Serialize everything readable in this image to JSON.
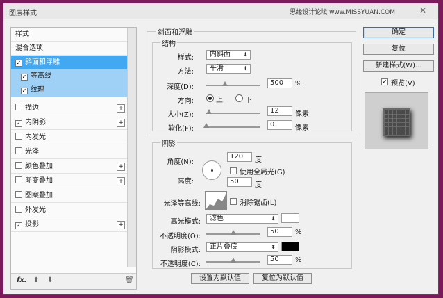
{
  "window": {
    "title": "图层样式",
    "watermark": "思缘设计论坛 www.MISSYUAN.COM",
    "close": "✕"
  },
  "styles_list": {
    "header": "样式",
    "items": [
      {
        "label": "混合选项",
        "checkbox": false,
        "plus": false,
        "state": "normal"
      },
      {
        "label": "斜面和浮雕",
        "checkbox": true,
        "checked": true,
        "plus": false,
        "state": "selected"
      },
      {
        "label": "等高线",
        "checkbox": true,
        "checked": true,
        "plus": false,
        "state": "sub"
      },
      {
        "label": "纹理",
        "checkbox": true,
        "checked": true,
        "plus": false,
        "state": "sub"
      },
      {
        "label": "描边",
        "checkbox": true,
        "checked": false,
        "plus": true,
        "state": "normal"
      },
      {
        "label": "内阴影",
        "checkbox": true,
        "checked": true,
        "plus": true,
        "state": "normal"
      },
      {
        "label": "内发光",
        "checkbox": true,
        "checked": false,
        "plus": false,
        "state": "normal"
      },
      {
        "label": "光泽",
        "checkbox": true,
        "checked": false,
        "plus": false,
        "state": "normal"
      },
      {
        "label": "颜色叠加",
        "checkbox": true,
        "checked": false,
        "plus": true,
        "state": "normal"
      },
      {
        "label": "渐变叠加",
        "checkbox": true,
        "checked": false,
        "plus": true,
        "state": "normal"
      },
      {
        "label": "图案叠加",
        "checkbox": true,
        "checked": false,
        "plus": false,
        "state": "normal"
      },
      {
        "label": "外发光",
        "checkbox": true,
        "checked": false,
        "plus": false,
        "state": "normal"
      },
      {
        "label": "投影",
        "checkbox": true,
        "checked": true,
        "plus": true,
        "state": "normal"
      }
    ],
    "footer": {
      "fx": "fx.",
      "up": "⬆",
      "down": "⬇",
      "trash": "🗑"
    }
  },
  "bevel": {
    "section_title": "斜面和浮雕",
    "structure_title": "结构",
    "style_label": "样式:",
    "style_value": "内斜面",
    "technique_label": "方法:",
    "technique_value": "平滑",
    "depth_label": "深度(D):",
    "depth_value": "500",
    "depth_unit": "%",
    "depth_level": 0.35,
    "direction_label": "方向:",
    "direction_up": "上",
    "direction_down": "下",
    "size_label": "大小(Z):",
    "size_value": "12",
    "size_unit": "像素",
    "size_level": 0.05,
    "soften_label": "软化(F):",
    "soften_value": "0",
    "soften_unit": "像素",
    "soften_level": 0.0
  },
  "shading": {
    "title": "阴影",
    "angle_label": "角度(N):",
    "angle_value": "120",
    "angle_unit": "度",
    "global_light_label": "使用全局光(G)",
    "altitude_label": "高度:",
    "altitude_value": "50",
    "altitude_unit": "度",
    "gloss_label": "光泽等高线:",
    "antialias_label": "消除锯齿(L)",
    "highlight_mode_label": "高光模式:",
    "highlight_mode_value": "滤色",
    "highlight_color": "#ffffff",
    "highlight_opacity_label": "不透明度(O):",
    "highlight_opacity_value": "50",
    "highlight_opacity_level": 0.5,
    "shadow_mode_label": "阴影模式:",
    "shadow_mode_value": "正片叠底",
    "shadow_color": "#000000",
    "shadow_opacity_label": "不透明度(C):",
    "shadow_opacity_value": "50",
    "shadow_opacity_level": 0.5,
    "opacity_unit": "%"
  },
  "defaults": {
    "make_default": "设置为默认值",
    "reset_default": "复位为默认值"
  },
  "right": {
    "ok": "确定",
    "reset": "复位",
    "new_style": "新建样式(W)...",
    "preview_label": "预览(V)"
  },
  "colors": {
    "selected": "#43a8f2",
    "sub": "#9fd0f6",
    "frame": "#7a1a5a"
  }
}
